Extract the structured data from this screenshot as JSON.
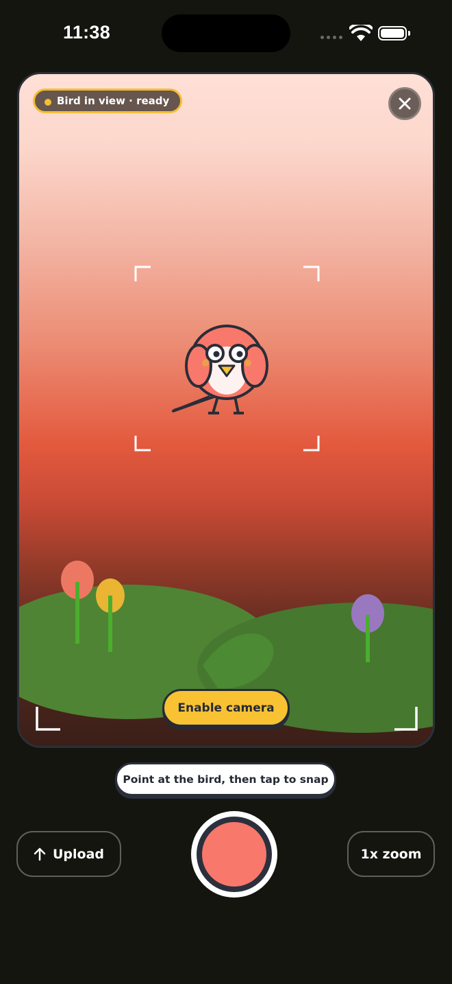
{
  "status_bar": {
    "time": "11:38"
  },
  "camera": {
    "status_label": "Bird in view · ready",
    "status_color": "#f4be33",
    "close_icon": "close-icon",
    "enable_label": "Enable camera"
  },
  "hint": {
    "text": "Point at the bird, then tap to snap"
  },
  "controls": {
    "upload_label": "Upload",
    "upload_icon": "arrow-up-icon",
    "zoom_label": "1x zoom",
    "shutter_color": "#f8786b"
  },
  "colors": {
    "accent": "#f8c233",
    "background": "#14150f",
    "bird": "#f8786b"
  }
}
